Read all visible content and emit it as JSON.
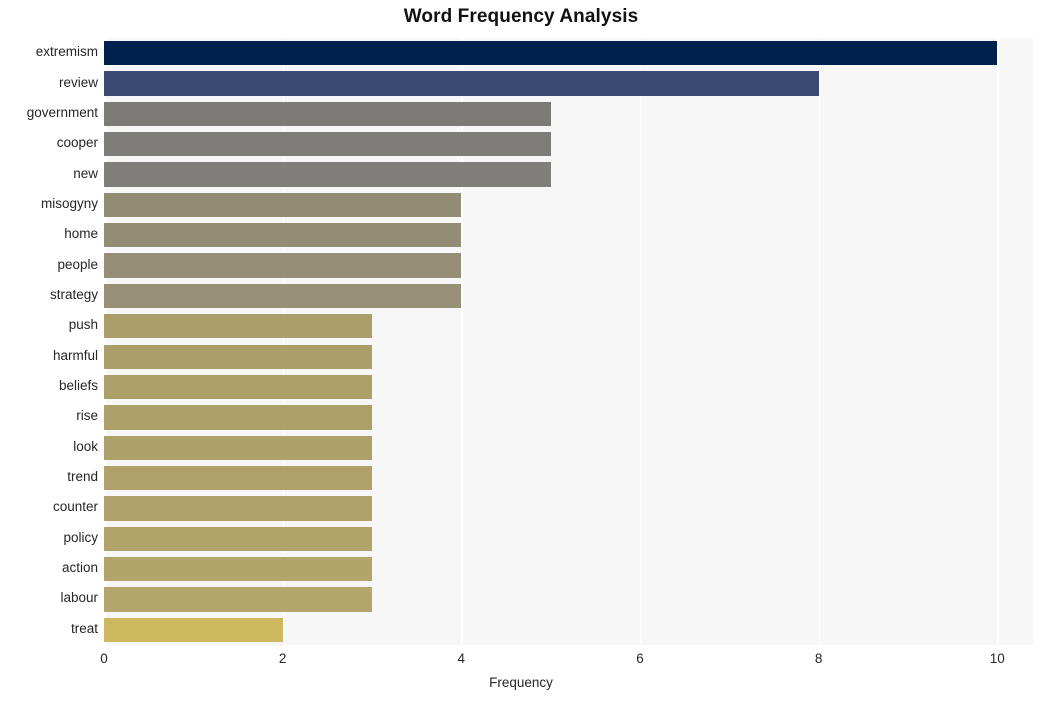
{
  "chart_data": {
    "type": "bar",
    "orientation": "horizontal",
    "title": "Word Frequency Analysis",
    "xlabel": "Frequency",
    "ylabel": "",
    "xlim": [
      0,
      10.4
    ],
    "xticks": [
      0,
      2,
      4,
      6,
      8,
      10
    ],
    "xtick_labels": [
      "0",
      "2",
      "4",
      "6",
      "8",
      "10"
    ],
    "grid": "vertical-white-on-gray",
    "legend": "none",
    "categories": [
      "extremism",
      "review",
      "government",
      "cooper",
      "new",
      "misogyny",
      "home",
      "people",
      "strategy",
      "push",
      "harmful",
      "beliefs",
      "rise",
      "look",
      "trend",
      "counter",
      "policy",
      "action",
      "labour",
      "treat"
    ],
    "values": [
      10,
      8,
      5,
      5,
      5,
      4,
      4,
      4,
      4,
      3,
      3,
      3,
      3,
      3,
      3,
      3,
      3,
      3,
      3,
      2
    ],
    "colors": [
      "#00214d",
      "#3a4a73",
      "#7b7a77",
      "#7d7c79",
      "#7f7e7a",
      "#938c74",
      "#948d75",
      "#968e76",
      "#978f77",
      "#ab9e68",
      "#ab9e68",
      "#ac9f68",
      "#ad9f68",
      "#aea069",
      "#afa169",
      "#b0a26a",
      "#b1a36a",
      "#b2a46b",
      "#b3a56b",
      "#ccb95f"
    ],
    "colormap": "cividis",
    "plot_background": "#f7f7f7",
    "figure_background": "#ffffff"
  }
}
